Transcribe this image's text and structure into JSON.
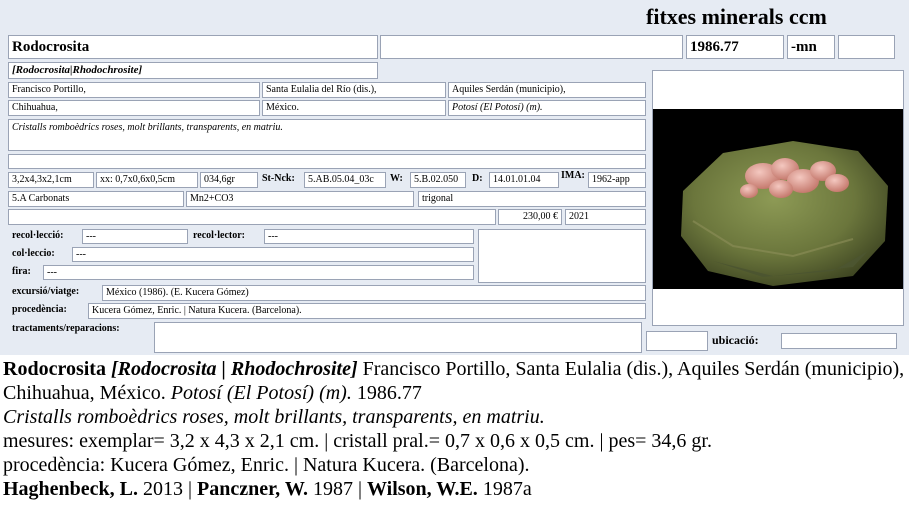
{
  "brand": "fitxes minerals ccm",
  "card": {
    "name": "Rodocrosita",
    "name_extra": "",
    "catalog_no": "1986.77",
    "suffix": "-mn",
    "suffix_extra": "",
    "synonyms": "[Rodocrosita|Rhodochrosite]",
    "locality1": "Francisco Portillo,",
    "locality2": "Santa Eulalia del Río (dis.),",
    "locality3": "Aquiles Serdán (municipio),",
    "locality4": "Chihuahua,",
    "locality5": "México.",
    "locality6": "Potosí (El Potosí) (m).",
    "description": "Cristalls romboèdrics roses, molt brillants, transparents, en matriu.",
    "blank_row": "",
    "dims": "3,2x4,3x2,1cm",
    "crystal": "xx: 0,7x0,6x0,5cm",
    "weight": "034,6gr",
    "stnck_label": "St-Nck:",
    "stnck": "5.AB.05.04_03c",
    "w_label": "W:",
    "w": "5.B.02.050",
    "d_label": "D:",
    "d": "14.01.01.04",
    "ima_label": "IMA:",
    "ima": "1962-app",
    "class": "5.A Carbonats",
    "formula": "Mn2+CO3",
    "system": "trigonal",
    "blank2": "",
    "price": "230,00 €",
    "year": "2021",
    "recolleccio_label": "recol·lecció:",
    "recolleccio": "---",
    "recollector_label": "recol·lector:",
    "recollector": "---",
    "colleccio_label": "col·leccio:",
    "colleccio": "---",
    "fira_label": "fira:",
    "fira": "---",
    "excursio_label": "excursió/viatge:",
    "excursio": "México (1986). (E. Kucera Gómez)",
    "procedencia_label": "procedència:",
    "procedencia": "Kucera Gómez, Enric. | Natura Kucera. (Barcelona).",
    "tractaments_label": "tractaments/reparacions:",
    "tractaments": "",
    "ubicacio_label": "ubicació:",
    "ubicacio": "",
    "notes": ""
  },
  "summary": {
    "name": "Rodocrosita",
    "synonyms": "[Rodocrosita | Rhodochrosite]",
    "locality": "Francisco Portillo, Santa Eulalia (dis.), Aquiles Serdán (municipio), Chihuahua, México.",
    "locality_italic": "Potosí (El Potosí) (m).",
    "catalog_no": "1986.77",
    "description": "Cristalls romboèdrics roses, molt brillants, transparents, en matriu.",
    "measures": "mesures: exemplar= 3,2 x 4,3 x 2,1 cm. | cristall pral.= 0,7 x 0,6 x 0,5 cm. | pes= 34,6 gr.",
    "provenance": "procedència: Kucera Gómez, Enric. | Natura Kucera. (Barcelona).",
    "refs": [
      {
        "author": "Haghenbeck, L.",
        "year": "2013"
      },
      {
        "author": "Panczner, W.",
        "year": "1987"
      },
      {
        "author": "Wilson, W.E.",
        "year": "1987a"
      }
    ],
    "sep": " | "
  },
  "colors": {
    "card_bg": "#e6ebf3",
    "field_border": "#9aa3b5",
    "matrix": "#6f7a3f",
    "crystal": "#d99a90"
  }
}
